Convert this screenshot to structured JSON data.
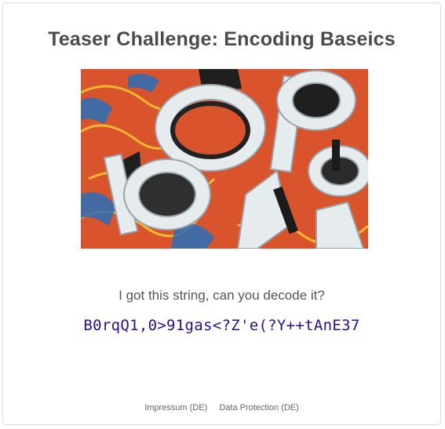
{
  "page": {
    "title": "Teaser Challenge: Encoding Baseics"
  },
  "challenge": {
    "question": "I got this string, can you decode it?",
    "encoded_string": "B0rqQ1,0>91gas<?Z'e(?Y++tAnE37"
  },
  "footer": {
    "links": [
      {
        "label": "Impressum (DE)"
      },
      {
        "label": "Data Protection (DE)"
      }
    ]
  },
  "colors": {
    "title": "#4a4a4a",
    "encoded_text": "#2a0f8a",
    "hero_background": "#e0562e"
  }
}
